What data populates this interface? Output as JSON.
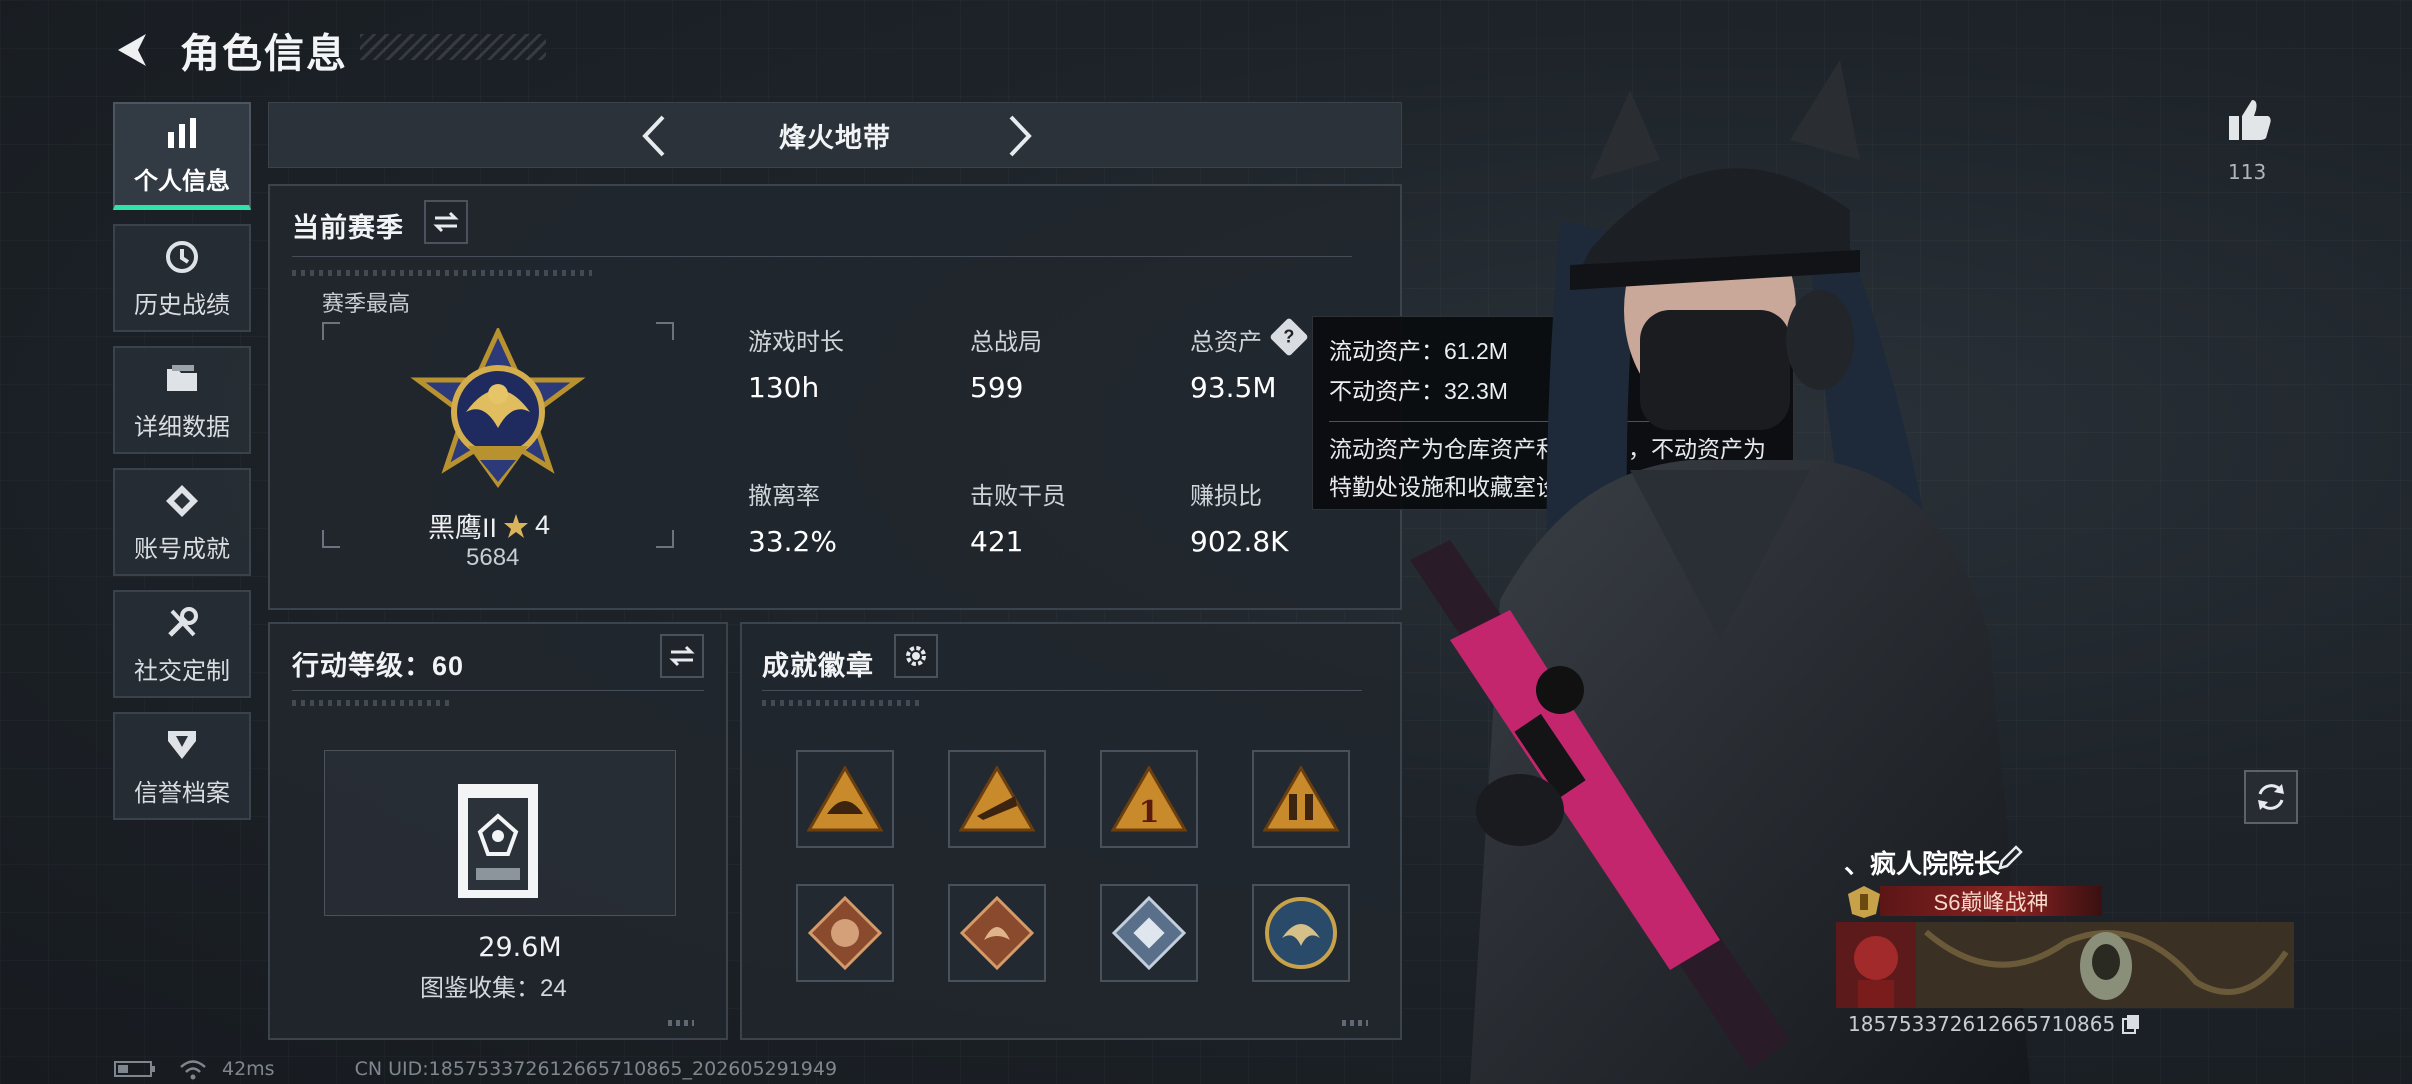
{
  "header": {
    "title": "角色信息"
  },
  "nav": {
    "items": [
      {
        "label": "个人信息",
        "icon": "bar-chart-icon",
        "active": true
      },
      {
        "label": "历史战绩",
        "icon": "history-icon"
      },
      {
        "label": "详细数据",
        "icon": "folder-icon"
      },
      {
        "label": "账号成就",
        "icon": "achievement-icon"
      },
      {
        "label": "社交定制",
        "icon": "wrench-icon"
      },
      {
        "label": "信誉档案",
        "icon": "credibility-icon"
      }
    ]
  },
  "mode": {
    "label": "烽火地带"
  },
  "season": {
    "title": "当前赛季",
    "best_label": "赛季最高",
    "rank_name": "黑鹰II",
    "rank_stars": "4",
    "rank_score": "5684",
    "stats": [
      {
        "label": "游戏时长",
        "value": "130h"
      },
      {
        "label": "总战局",
        "value": "599"
      },
      {
        "label": "总资产",
        "value": "93.5M"
      },
      {
        "label": "撤离率",
        "value": "33.2%"
      },
      {
        "label": "击败干员",
        "value": "421"
      },
      {
        "label": "赚损比",
        "value": "902.8K"
      }
    ]
  },
  "tooltip": {
    "liquid": "流动资产：61.2M",
    "fixed": "不动资产：32.3M",
    "desc": "流动资产为仓库资产和哈夫币，不动资产为特勤处设施和收藏室设施"
  },
  "action": {
    "title": "行动等级：60",
    "collection_value": "29.6M",
    "collection_count": "图鉴收集：24"
  },
  "badges": {
    "title": "成就徽章",
    "items": [
      "triangle-badge-1",
      "triangle-badge-2",
      "triangle-badge-3",
      "triangle-badge-4",
      "diamond-badge-1",
      "diamond-badge-2",
      "diamond-badge-3",
      "round-badge"
    ]
  },
  "likes": {
    "count": "113"
  },
  "player": {
    "name": "、疯人院院长",
    "title": "S6巅峰战神",
    "uid": "1857533726126657108​65"
  },
  "status": {
    "ping": "42ms",
    "uid_line": "CN UID:185753372612665710865_202605291949"
  },
  "colors": {
    "accent": "#2fe3a9",
    "gold": "#c8a24a",
    "title_red": "#8b2222"
  }
}
